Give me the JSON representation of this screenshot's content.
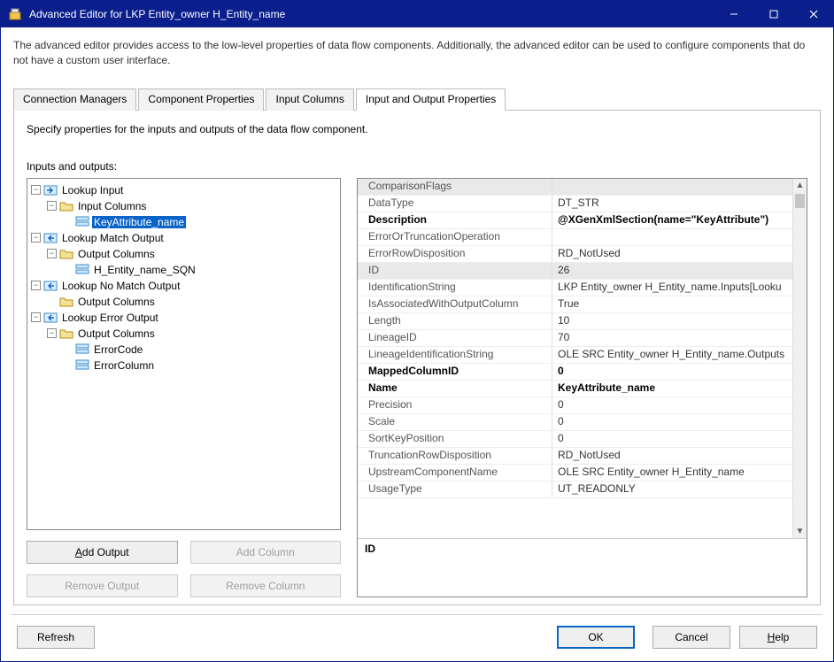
{
  "window": {
    "title": "Advanced Editor for LKP Entity_owner H_Entity_name"
  },
  "description": "The advanced editor provides access to the low-level properties of data flow components. Additionally, the advanced editor can be used to configure components that do not have a custom user interface.",
  "tabs": {
    "t0": "Connection Managers",
    "t1": "Component Properties",
    "t2": "Input Columns",
    "t3": "Input and Output Properties"
  },
  "panel": {
    "msg": "Specify properties for the inputs and outputs of the data flow component.",
    "io_label": "Inputs and outputs:"
  },
  "tree": {
    "n0": "Lookup Input",
    "n0_0": "Input Columns",
    "n0_0_0": "KeyAttribute_name",
    "n1": "Lookup Match Output",
    "n1_0": "Output Columns",
    "n1_0_0": "H_Entity_name_SQN",
    "n2": "Lookup No Match Output",
    "n2_0": "Output Columns",
    "n3": "Lookup Error Output",
    "n3_0": "Output Columns",
    "n3_0_0": "ErrorCode",
    "n3_0_1": "ErrorColumn"
  },
  "buttons": {
    "add_output": "Add Output",
    "add_column": "Add Column",
    "remove_output": "Remove Output",
    "remove_column": "Remove Column",
    "refresh": "Refresh",
    "ok": "OK",
    "cancel": "Cancel",
    "help": "Help"
  },
  "props": [
    {
      "name": "ComparisonFlags",
      "value": "",
      "bold": false,
      "hdr": true
    },
    {
      "name": "DataType",
      "value": "DT_STR",
      "bold": false
    },
    {
      "name": "Description",
      "value": "@XGenXmlSection(name=\"KeyAttribute\")",
      "bold": true
    },
    {
      "name": "ErrorOrTruncationOperation",
      "value": "",
      "bold": false
    },
    {
      "name": "ErrorRowDisposition",
      "value": "RD_NotUsed",
      "bold": false
    },
    {
      "name": "ID",
      "value": "26",
      "bold": false,
      "hdr": true
    },
    {
      "name": "IdentificationString",
      "value": "LKP Entity_owner H_Entity_name.Inputs[Looku",
      "bold": false
    },
    {
      "name": "IsAssociatedWithOutputColumn",
      "value": "True",
      "bold": false
    },
    {
      "name": "Length",
      "value": "10",
      "bold": false
    },
    {
      "name": "LineageID",
      "value": "70",
      "bold": false
    },
    {
      "name": "LineageIdentificationString",
      "value": "OLE SRC Entity_owner H_Entity_name.Outputs",
      "bold": false
    },
    {
      "name": "MappedColumnID",
      "value": "0",
      "bold": true
    },
    {
      "name": "Name",
      "value": "KeyAttribute_name",
      "bold": true
    },
    {
      "name": "Precision",
      "value": "0",
      "bold": false
    },
    {
      "name": "Scale",
      "value": "0",
      "bold": false
    },
    {
      "name": "SortKeyPosition",
      "value": "0",
      "bold": false
    },
    {
      "name": "TruncationRowDisposition",
      "value": "RD_NotUsed",
      "bold": false
    },
    {
      "name": "UpstreamComponentName",
      "value": "OLE SRC Entity_owner H_Entity_name",
      "bold": false
    },
    {
      "name": "UsageType",
      "value": "UT_READONLY",
      "bold": false
    }
  ],
  "propdesc": {
    "label": "ID"
  }
}
